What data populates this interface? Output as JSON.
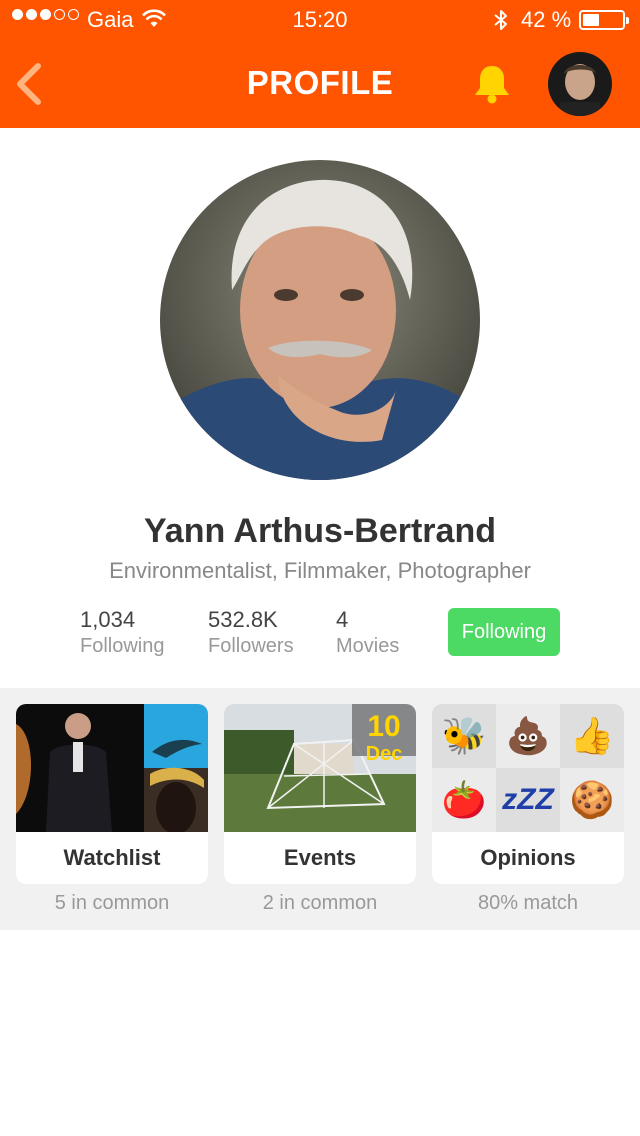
{
  "status_bar": {
    "carrier": "Gaia",
    "time": "15:20",
    "battery_percent": "42 %",
    "battery_level": 0.42,
    "signal_strength": 3
  },
  "nav": {
    "title": "PROFILE",
    "accent_color": "#ff5500",
    "icons": [
      "chevron-left-icon",
      "bell-icon"
    ]
  },
  "profile": {
    "name": "Yann Arthus-Bertrand",
    "subtitle": "Environmentalist, Filmmaker, Photographer",
    "stats": [
      {
        "value": "1,034",
        "label": "Following"
      },
      {
        "value": "532.8K",
        "label": "Followers"
      },
      {
        "value": "4",
        "label": "Movies"
      }
    ],
    "follow_button": "Following",
    "follow_color": "#4cd964"
  },
  "cards": [
    {
      "label": "Watchlist",
      "caption": "5 in common"
    },
    {
      "label": "Events",
      "caption": "2 in common",
      "date_day": "10",
      "date_month": "Dec"
    },
    {
      "label": "Opinions",
      "caption": "80% match",
      "emojis": [
        "🐝",
        "💩",
        "👍",
        "🍅",
        "zZZ",
        "🍪"
      ]
    }
  ]
}
